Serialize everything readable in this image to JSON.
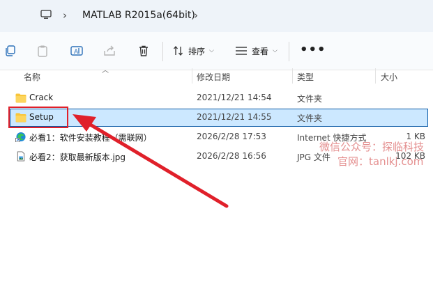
{
  "address": {
    "path": "MATLAB R2015a(64bit)"
  },
  "toolbar": {
    "sort_label": "排序",
    "view_label": "查看",
    "more_label": "•••"
  },
  "columns": {
    "name": "名称",
    "date": "修改日期",
    "type": "类型",
    "size": "大小"
  },
  "files": [
    {
      "name": "Crack",
      "date": "2021/12/21 14:54",
      "type": "文件夹",
      "size": "",
      "icon": "folder-icon"
    },
    {
      "name": "Setup",
      "date": "2021/12/21 14:55",
      "type": "文件夹",
      "size": "",
      "icon": "folder-icon",
      "selected": true
    },
    {
      "name": "必看1：软件安装教程（需联网）",
      "date": "2026/2/28 17:53",
      "type": "Internet 快捷方式",
      "size": "1 KB",
      "icon": "edge-shortcut-icon"
    },
    {
      "name": "必看2：获取最新版本.jpg",
      "date": "2026/2/28 16:56",
      "type": "JPG 文件",
      "size": "102 KB",
      "icon": "image-file-icon"
    }
  ],
  "watermark": {
    "line1": "微信公众号：探临科技",
    "line2": "官网：tanlkj.com"
  },
  "colors": {
    "selection": "#cce8ff",
    "selection_border": "#0a5aa6",
    "annotation_red": "#e0202a",
    "folder_yellow": "#f8c53a"
  }
}
